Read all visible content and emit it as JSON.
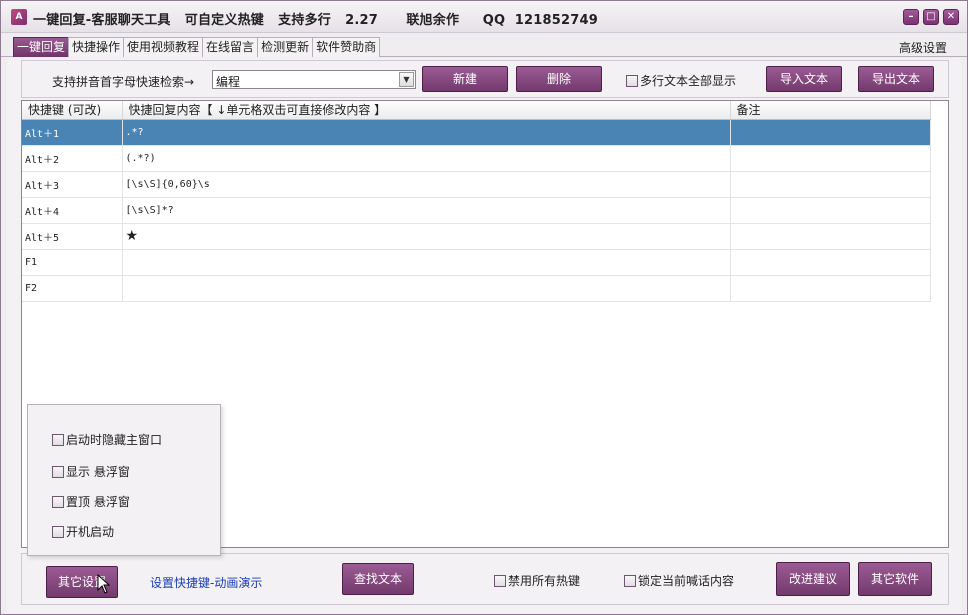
{
  "window": {
    "title": "一键回复-客服聊天工具   可自定义热键   支持多行   2.27      联旭余作     QQ  121852749"
  },
  "tabs": [
    {
      "label": "一键回复",
      "active": true
    },
    {
      "label": "快捷操作",
      "active": false
    },
    {
      "label": "使用视频教程",
      "active": false
    },
    {
      "label": "在线留言",
      "active": false
    },
    {
      "label": "检测更新",
      "active": false
    },
    {
      "label": "软件赞助商",
      "active": false
    }
  ],
  "advanced_settings_label": "高级设置",
  "toolbar": {
    "search_label": "支持拼音首字母快速检索→",
    "search_value": "编程",
    "new_button": "新建",
    "delete_button": "删除",
    "show_all_multiline": "多行文本全部显示",
    "import_button": "导入文本",
    "export_button": "导出文本"
  },
  "grid": {
    "columns": [
      "快捷键 (可改)",
      "快捷回复内容【 ↓单元格双击可直接修改内容 】",
      "备注"
    ],
    "rows": [
      {
        "hotkey": "Alt＋1",
        "content": ".*?",
        "note": ""
      },
      {
        "hotkey": "Alt＋2",
        "content": "(.*?)",
        "note": ""
      },
      {
        "hotkey": "Alt＋3",
        "content": "[\\s\\S]{0,60}\\s",
        "note": ""
      },
      {
        "hotkey": "Alt＋4",
        "content": "[\\s\\S]*?",
        "note": ""
      },
      {
        "hotkey": "Alt＋5",
        "content": "★",
        "note": ""
      },
      {
        "hotkey": "F1",
        "content": "",
        "note": ""
      },
      {
        "hotkey": "F2",
        "content": "",
        "note": ""
      }
    ],
    "selected_row": 0
  },
  "popup_options": [
    "启动时隐藏主窗口",
    "显示 悬浮窗",
    "置顶 悬浮窗",
    "开机启动"
  ],
  "bottom": {
    "other_settings_button": "其它设置",
    "hotkey_demo_link": "设置快捷键-动画演示",
    "find_text_button": "查找文本",
    "disable_hotkeys": "禁用所有热键",
    "lock_current": "锁定当前喊话内容",
    "suggest_button": "改进建议",
    "other_software_button": "其它软件"
  },
  "colors": {
    "accent": "#7a3a72",
    "selection": "#4a84b5",
    "link": "#1a3cb8"
  }
}
